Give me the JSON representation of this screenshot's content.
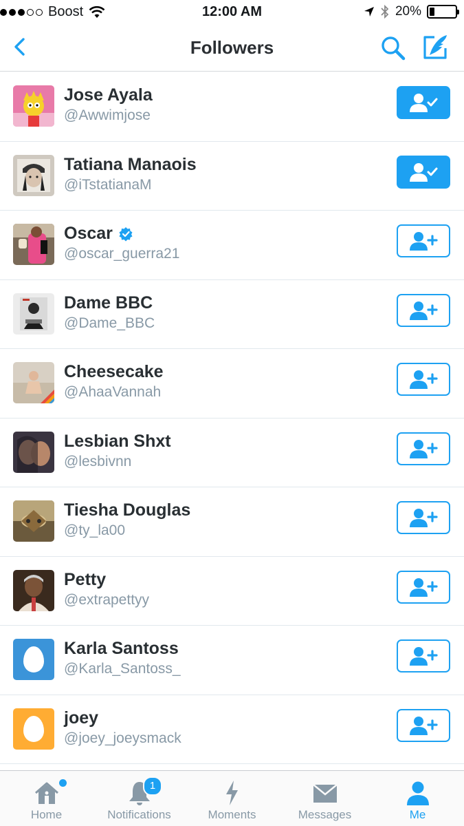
{
  "status_bar": {
    "carrier": "Boost",
    "time": "12:00 AM",
    "battery": "20%",
    "battery_level": 0.2
  },
  "nav": {
    "title": "Followers",
    "back_icon": "chevron-left-icon",
    "search_icon": "search-icon",
    "compose_icon": "compose-tweet-icon"
  },
  "colors": {
    "accent": "#1da1f2",
    "handle": "#8899a6",
    "egg_blue": "#3b94d9",
    "egg_orange": "#ffac33"
  },
  "followers": [
    {
      "name": "Jose Ayala",
      "handle": "@Awwimjose",
      "following": true,
      "verified": false
    },
    {
      "name": "Tatiana Manaois",
      "handle": "@iTstatianaM",
      "following": true,
      "verified": false
    },
    {
      "name": "Oscar",
      "handle": "@oscar_guerra21",
      "following": false,
      "verified": true
    },
    {
      "name": "Dame BBC",
      "handle": "@Dame_BBC",
      "following": false,
      "verified": false
    },
    {
      "name": "Cheesecake",
      "handle": "@AhaaVannah",
      "following": false,
      "verified": false
    },
    {
      "name": "Lesbian Shxt",
      "handle": "@lesbivnn",
      "following": false,
      "verified": false
    },
    {
      "name": "Tiesha Douglas",
      "handle": "@ty_la00",
      "following": false,
      "verified": false
    },
    {
      "name": "Petty",
      "handle": "@extrapettyy",
      "following": false,
      "verified": false
    },
    {
      "name": "Karla Santoss",
      "handle": "@Karla_Santoss_",
      "following": false,
      "verified": false
    },
    {
      "name": "joey",
      "handle": "@joey_joeysmack",
      "following": false,
      "verified": false
    }
  ],
  "tabs": [
    {
      "label": "Home",
      "icon": "home-icon",
      "active": false,
      "dot": true
    },
    {
      "label": "Notifications",
      "icon": "bell-icon",
      "active": false,
      "badge": "1"
    },
    {
      "label": "Moments",
      "icon": "lightning-icon",
      "active": false
    },
    {
      "label": "Messages",
      "icon": "envelope-icon",
      "active": false
    },
    {
      "label": "Me",
      "icon": "person-icon",
      "active": true
    }
  ]
}
